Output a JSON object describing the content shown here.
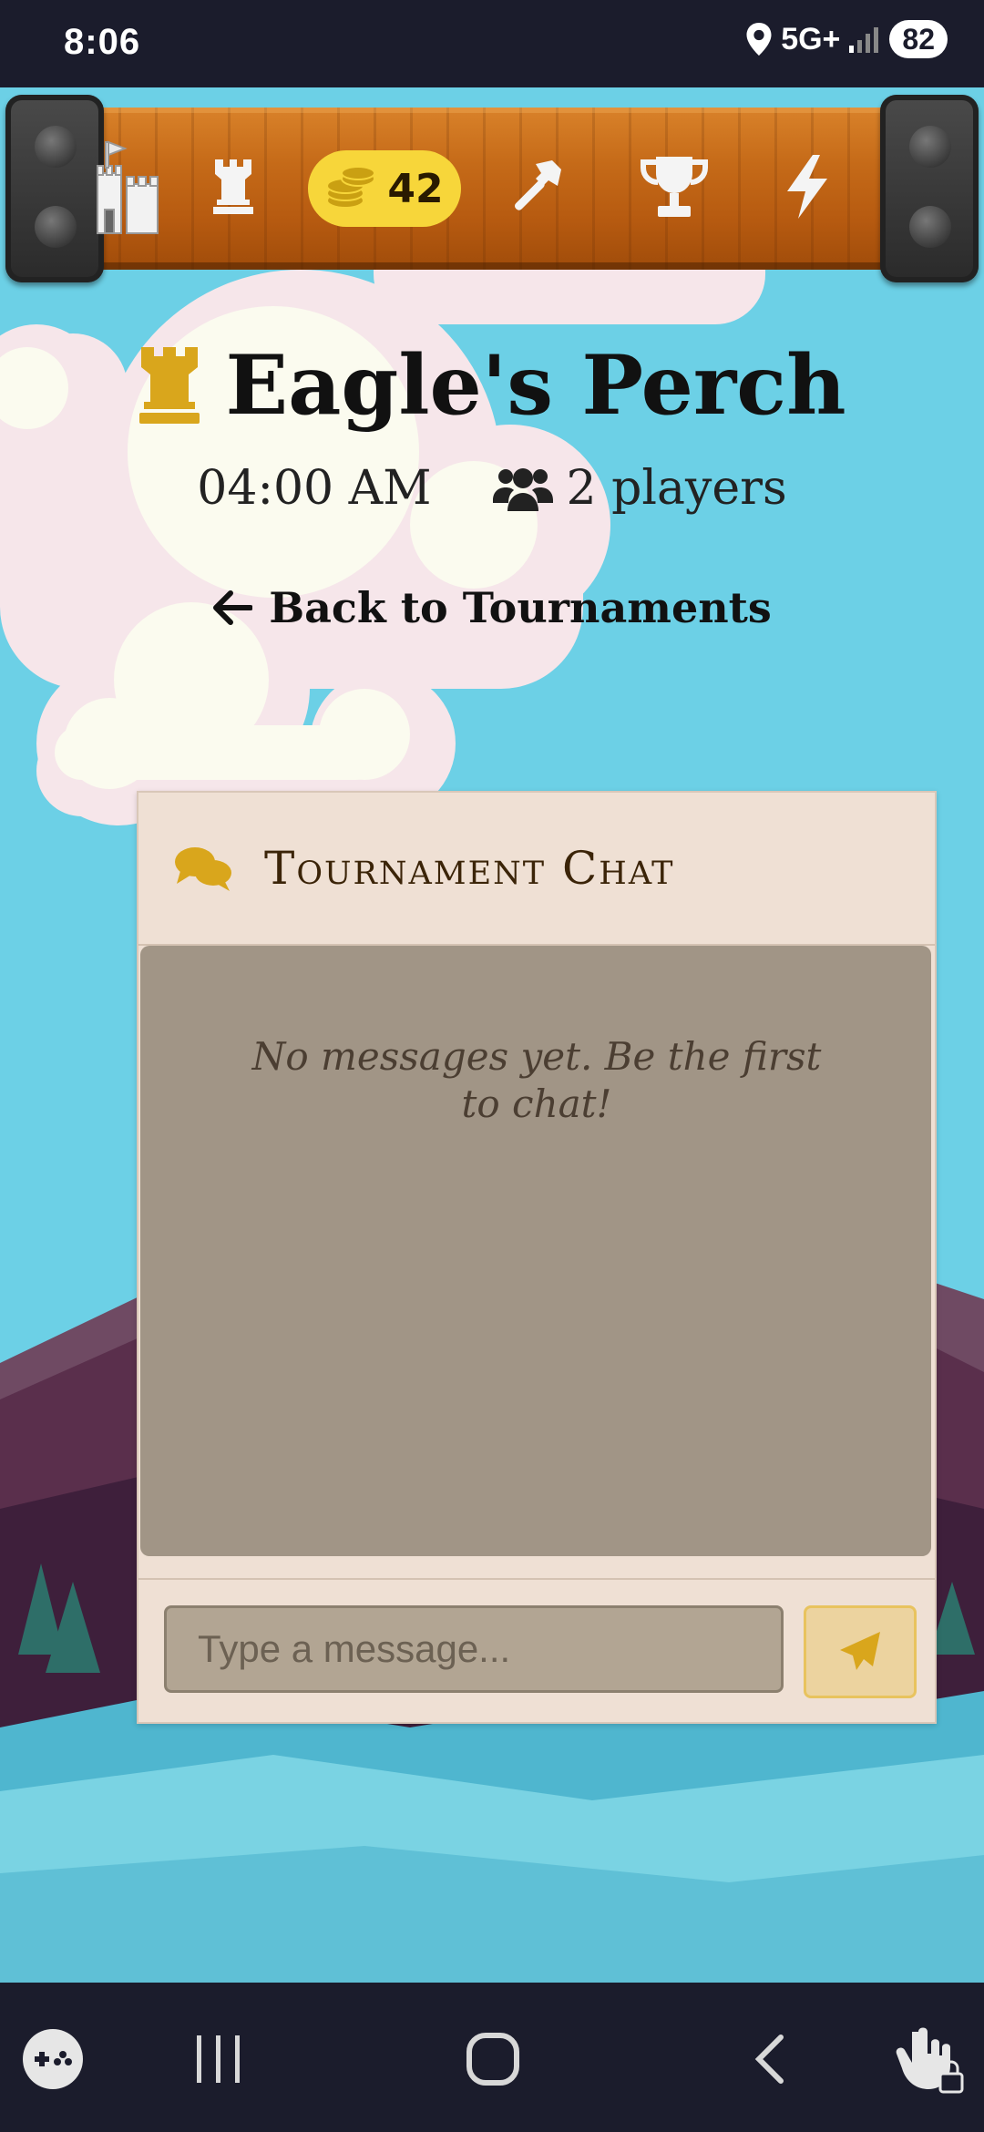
{
  "status_bar": {
    "time": "8:06",
    "network": "5G+",
    "battery": "82"
  },
  "header": {
    "coins": "42"
  },
  "tournament": {
    "name": "Eagle's Perch",
    "time": "04:00 AM",
    "players": "2 players",
    "back_label": "Back to Tournaments"
  },
  "chat": {
    "title": "Tournament Chat",
    "empty_message": "No messages yet. Be the first to chat!",
    "input_placeholder": "Type a message..."
  },
  "colors": {
    "accent_gold": "#d9a61c",
    "sky": "#6cd0e6",
    "coin_pill": "#f7d63a"
  }
}
